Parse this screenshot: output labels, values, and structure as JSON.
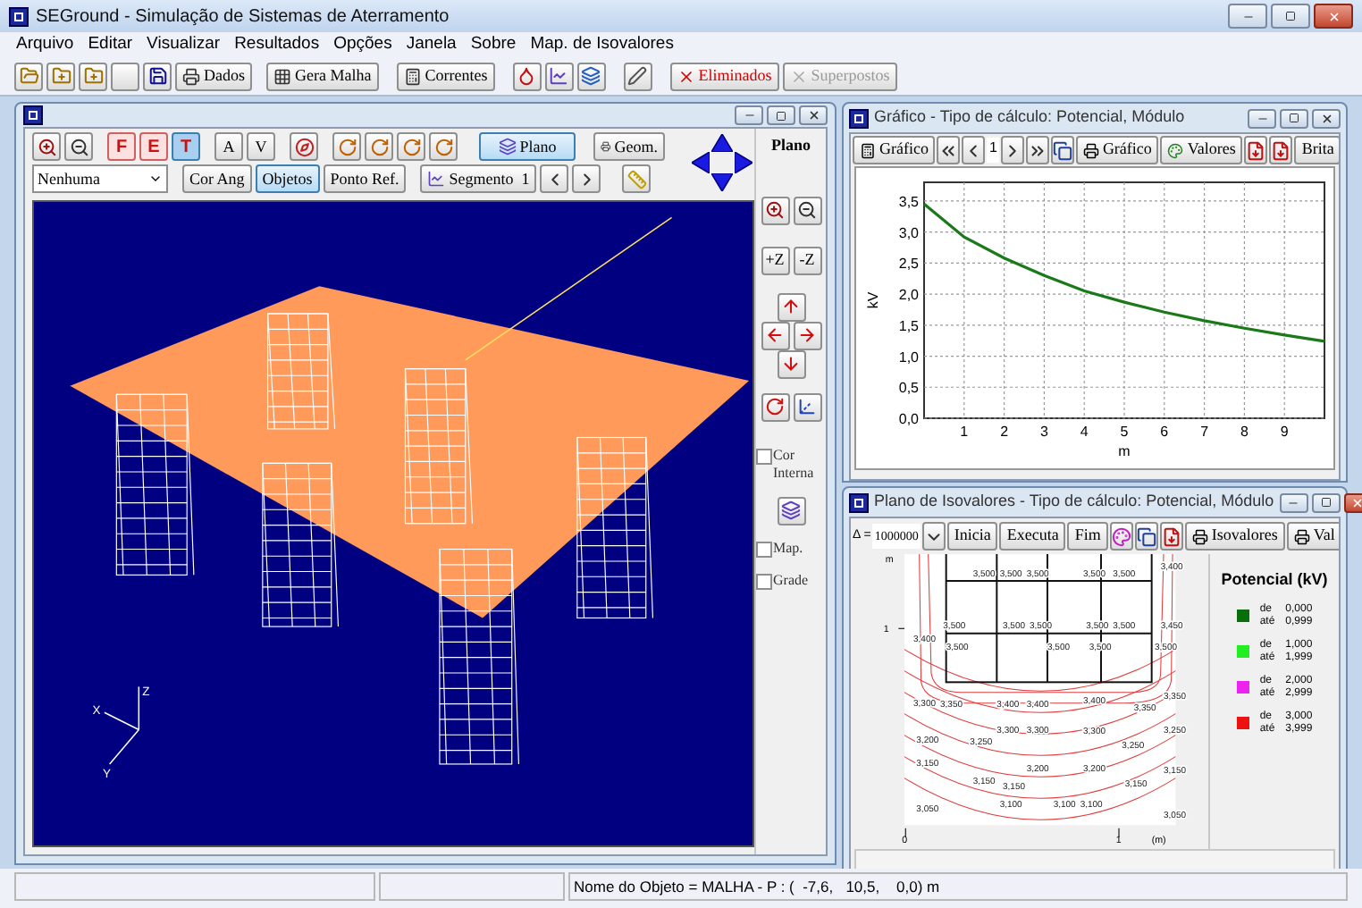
{
  "window": {
    "title": "SEGround - Simulação de Sistemas de Aterramento"
  },
  "menu": [
    "Arquivo",
    "Editar",
    "Visualizar",
    "Resultados",
    "Opções",
    "Janela",
    "Sobre",
    "Map. de Isovalores"
  ],
  "toolbar": [
    {
      "label": "Dados",
      "kind": "plain",
      "disabled": false
    },
    {
      "label": "Gera Malha",
      "kind": "plain",
      "disabled": false
    },
    {
      "label": "Correntes",
      "kind": "plain",
      "disabled": false
    },
    {
      "label": "Eliminados",
      "kind": "alert",
      "disabled": false
    },
    {
      "label": "Superpostos",
      "kind": "plain",
      "disabled": true
    }
  ],
  "view_window": {
    "letter_toggles": [
      {
        "label": "F",
        "selected": false
      },
      {
        "label": "E",
        "selected": false
      },
      {
        "label": "T",
        "selected": true
      }
    ],
    "text_toggles": [
      "A",
      "V"
    ],
    "plane_button": {
      "label": "Plano",
      "selected": true
    },
    "geom_button": {
      "label": "Geom."
    },
    "color_select": {
      "value": "Nenhuma"
    },
    "row2_buttons": [
      {
        "label": "Cor Ang",
        "selected": false
      },
      {
        "label": "Objetos",
        "selected": true
      },
      {
        "label": "Ponto Ref.",
        "selected": false
      }
    ],
    "segment_button": {
      "label": "Segmento  1"
    },
    "axes": {
      "x": "X",
      "y": "Y",
      "z": "Z"
    },
    "side_panel": {
      "title": "Plano",
      "z_buttons": [
        "+Z",
        "-Z"
      ],
      "checkboxes": [
        {
          "label": "Cor Interna",
          "checked": false
        },
        {
          "label": "Map.",
          "checked": false
        },
        {
          "label": "Grade",
          "checked": false
        }
      ]
    }
  },
  "graph_window": {
    "title": "Gráfico - Tipo de cálculo: Potencial, Módulo",
    "buttons": [
      "Gráfico",
      "Gráfico",
      "Valores",
      "Brita"
    ],
    "page": "1",
    "chart_data": {
      "type": "line",
      "xlabel": "m",
      "ylabel": "kV",
      "x": [
        0,
        1,
        2,
        3,
        4,
        5,
        6,
        7,
        8,
        9,
        10
      ],
      "series": [
        {
          "color": "#1a7a1a",
          "values": [
            3.45,
            2.92,
            2.58,
            2.3,
            2.05,
            1.87,
            1.71,
            1.57,
            1.45,
            1.34,
            1.24
          ]
        }
      ],
      "grid": true,
      "xlim": [
        0,
        10
      ],
      "ylim": [
        0,
        3.8
      ],
      "xticks": [
        1,
        2,
        3,
        4,
        5,
        6,
        7,
        8,
        9
      ],
      "yticks": [
        {
          "value": 0,
          "label": "0,0"
        },
        {
          "value": 0.5,
          "label": "0,5"
        },
        {
          "value": 1,
          "label": "1,0"
        },
        {
          "value": 1.5,
          "label": "1,5"
        },
        {
          "value": 2,
          "label": "2,0"
        },
        {
          "value": 2.5,
          "label": "2,5"
        },
        {
          "value": 3,
          "label": "3,0"
        },
        {
          "value": 3.5,
          "label": "3,5"
        }
      ]
    }
  },
  "isovalue_window": {
    "title": "Plano de Isovalores - Tipo de cálculo: Potencial, Módulo",
    "delta_label": "Δ =",
    "delta_value": "1000000",
    "buttons": [
      "Inicia",
      "Executa",
      "Fim"
    ],
    "print_buttons": [
      "Isovalores",
      "Val"
    ],
    "axis_labels": {
      "y_unit": "m",
      "y_tick": "1",
      "x_ticks": [
        "0",
        "1"
      ],
      "x_unit": "(m)"
    },
    "contour_labels": [
      "3,400",
      "3,500",
      "3,500",
      "3,500",
      "3,500",
      "3,500",
      "3,400",
      "3,500",
      "3,500",
      "3,500",
      "3,500",
      "3,500",
      "3,450",
      "3,500",
      "3,500",
      "3,500",
      "3,500",
      "3,300",
      "3,350",
      "3,400",
      "3,400",
      "3,400",
      "3,350",
      "3,350",
      "3,200",
      "3,250",
      "3,300",
      "3,300",
      "3,300",
      "3,250",
      "3,250",
      "3,150",
      "3,150",
      "3,150",
      "3,200",
      "3,200",
      "3,150",
      "3,150",
      "3,050",
      "3,100",
      "3,100",
      "3,100",
      "3,050"
    ],
    "legend": {
      "title": "Potencial (kV)",
      "items": [
        {
          "color": "#0a6e0a",
          "from_label": "de",
          "to_label": "até",
          "from": "0,000",
          "to": "0,999"
        },
        {
          "color": "#22ee22",
          "from_label": "de",
          "to_label": "até",
          "from": "1,000",
          "to": "1,999"
        },
        {
          "color": "#ee22ee",
          "from_label": "de",
          "to_label": "até",
          "from": "2,000",
          "to": "2,999"
        },
        {
          "color": "#ee1111",
          "from_label": "de",
          "to_label": "até",
          "from": "3,000",
          "to": "3,999"
        }
      ]
    }
  },
  "status_bar": {
    "object_info": "Nome do Objeto = MALHA - P : (  -7,6,   10,5,    0,0) m"
  }
}
